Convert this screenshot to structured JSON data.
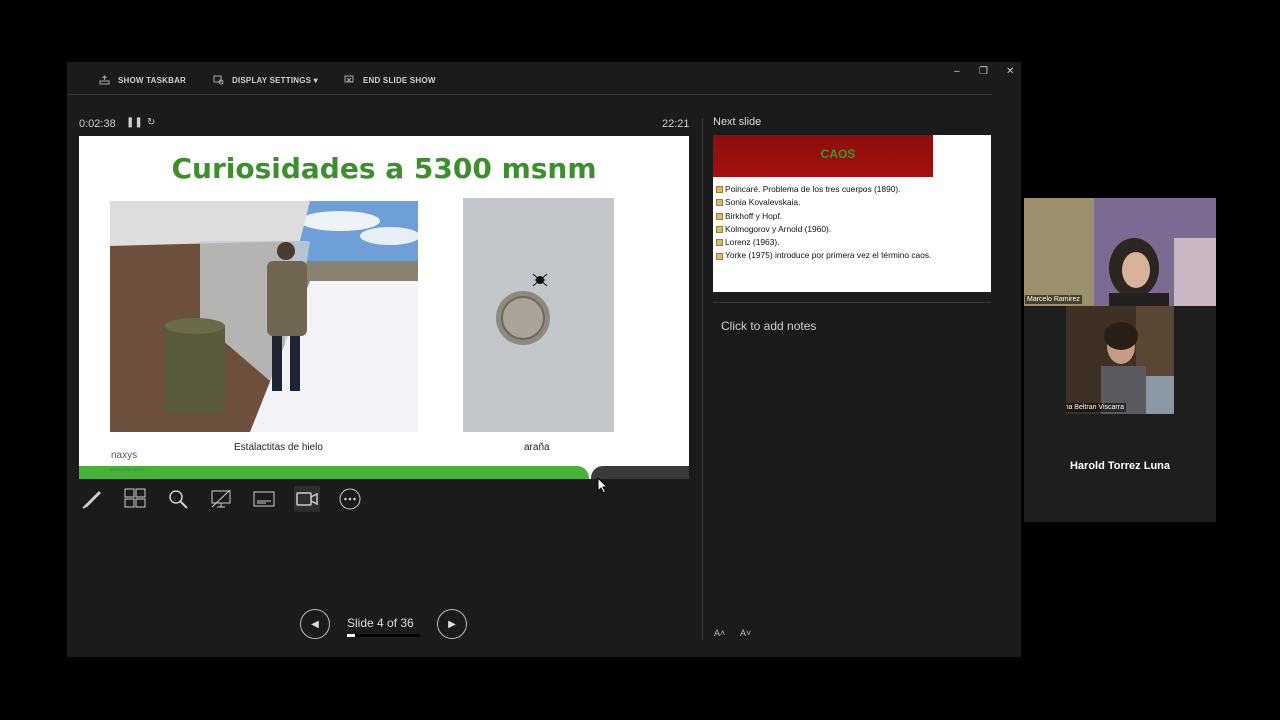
{
  "toolbar": {
    "show_taskbar": "SHOW TASKBAR",
    "display_settings": "DISPLAY SETTINGS ▾",
    "end_slide_show": "END SLIDE SHOW"
  },
  "window_controls": {
    "minimize": "–",
    "restore": "❐",
    "close": "✕"
  },
  "presenter": {
    "elapsed": "0:02:38",
    "clock": "22:21",
    "next_slide_label": "Next slide",
    "notes_placeholder": "Click to add notes",
    "slide_counter": "Slide 4 of 36",
    "progress_fraction": 0.11
  },
  "slide": {
    "title": "Curiosidades a 5300 msnm",
    "caption_left": "Estalactitas de hielo",
    "caption_right": "araña",
    "logo": "naxys",
    "logo_url": "www.unamur.be"
  },
  "next_slide": {
    "title": "CAOS",
    "items": [
      "Poincaré. Problema de los tres cuerpos (1890).",
      "Sonia Kovalevskaia.",
      "Birkhoff y Hopf.",
      "Kolmogorov y Arnold (1960).",
      "Lorenz (1963).",
      "Yorke (1975) introduce por primera vez el término caos."
    ]
  },
  "font_controls": {
    "increase": "A˄",
    "decrease": "A˅"
  },
  "participants": {
    "cam1_name": "Marcelo Ramirez",
    "cam2_name": "Micaela Diana Beltran Viscarra",
    "host_name": "Harold Torrez Luna"
  },
  "colors": {
    "title_green": "#3c8f2c",
    "banner_red": "#a80f0f",
    "background": "#1b1b1b"
  }
}
